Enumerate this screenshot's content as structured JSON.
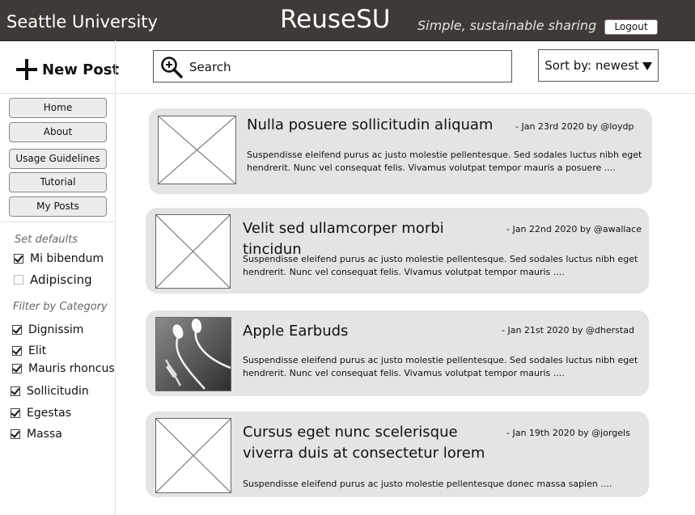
{
  "header": {
    "school": "Seattle University",
    "app_title": "ReuseSU",
    "tagline": "Simple, sustainable sharing",
    "logout_label": "Logout"
  },
  "toolbar": {
    "new_post_label": "New Post",
    "search_placeholder": "Search",
    "sort_label": "Sort by: newest"
  },
  "sidebar": {
    "nav": [
      {
        "label": "Home"
      },
      {
        "label": "About"
      },
      {
        "label": "Usage Guidelines"
      },
      {
        "label": "Tutorial"
      },
      {
        "label": "My Posts"
      }
    ],
    "defaults_title": "Set defaults",
    "defaults": [
      {
        "label": "Mi bibendum",
        "checked": true
      },
      {
        "label": "Adipiscing",
        "checked": false
      }
    ],
    "filter_title": "Filter by Category",
    "categories": [
      {
        "label": "Dignissim",
        "checked": true
      },
      {
        "label": "Elit",
        "checked": true
      },
      {
        "label": "Mauris rhoncus",
        "checked": true
      },
      {
        "label": "Sollicitudin",
        "checked": true
      },
      {
        "label": "Egestas",
        "checked": true
      },
      {
        "label": "Massa",
        "checked": true
      }
    ]
  },
  "posts": [
    {
      "title": "Nulla posuere sollicitudin aliquam",
      "meta": "- Jan 23rd 2020 by @loydp",
      "body": "Suspendisse eleifend purus ac justo molestie pellentesque. Sed sodales luctus nibh eget hendrerit. Nunc vel consequat felis. Vivamus volutpat tempor mauris a posuere ....",
      "image": "placeholder"
    },
    {
      "title": "Velit sed ullamcorper morbi tincidun",
      "meta": "- Jan 22nd 2020 by @awallace",
      "body": "Suspendisse eleifend purus ac justo molestie pellentesque. Sed sodales luctus nibh eget hendrerit. Nunc vel consequat felis. Vivamus volutpat tempor mauris ....",
      "image": "placeholder"
    },
    {
      "title": "Apple Earbuds",
      "meta": "- Jan 21st 2020 by @dherstad",
      "body": "Suspendisse eleifend purus ac justo molestie pellentesque. Sed sodales luctus nibh eget hendrerit. Nunc vel consequat felis. Vivamus volutpat tempor mauris ....",
      "image": "earbuds-photo"
    },
    {
      "title": "Cursus eget nunc scelerisque viverra duis at consectetur lorem",
      "meta": "- Jan 19th 2020 by @jorgels",
      "body": "Suspendisse eleifend purus ac justo molestie pellentesque donec massa sapien ....",
      "image": "placeholder"
    }
  ]
}
